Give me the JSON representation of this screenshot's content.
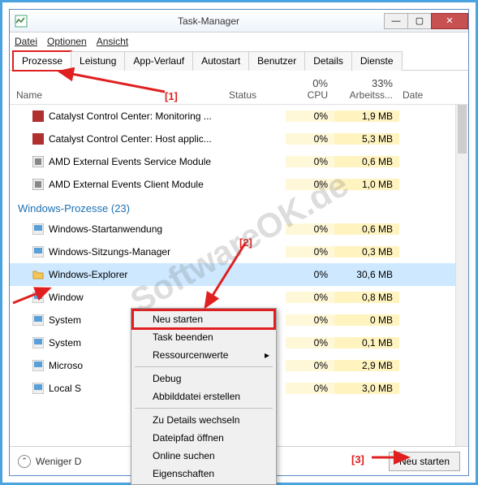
{
  "window": {
    "title": "Task-Manager",
    "btn_min": "—",
    "btn_max": "▢",
    "btn_close": "✕"
  },
  "menubar": {
    "file": "Datei",
    "options": "Optionen",
    "view": "Ansicht"
  },
  "tabs": {
    "items": [
      {
        "label": "Prozesse",
        "active": true
      },
      {
        "label": "Leistung"
      },
      {
        "label": "App-Verlauf"
      },
      {
        "label": "Autostart"
      },
      {
        "label": "Benutzer"
      },
      {
        "label": "Details"
      },
      {
        "label": "Dienste"
      }
    ]
  },
  "columns": {
    "name": "Name",
    "status": "Status",
    "cpu_pct": "0%",
    "cpu_label": "CPU",
    "mem_pct": "33%",
    "mem_label": "Arbeitss...",
    "date": "Date"
  },
  "processes": [
    {
      "name": "Catalyst Control Center: Monitoring ...",
      "cpu": "0%",
      "mem": "1,9 MB",
      "icon": "ccc"
    },
    {
      "name": "Catalyst Control Center: Host applic...",
      "cpu": "0%",
      "mem": "5,3 MB",
      "icon": "ccc"
    },
    {
      "name": "AMD External Events Service Module",
      "cpu": "0%",
      "mem": "0,6 MB",
      "icon": "amd"
    },
    {
      "name": "AMD External Events Client Module",
      "cpu": "0%",
      "mem": "1,0 MB",
      "icon": "amd"
    }
  ],
  "group": {
    "label": "Windows-Prozesse (23)"
  },
  "winprocs": [
    {
      "name": "Windows-Startanwendung",
      "cpu": "0%",
      "mem": "0,6 MB"
    },
    {
      "name": "Windows-Sitzungs-Manager",
      "cpu": "0%",
      "mem": "0,3 MB"
    },
    {
      "name": "Windows-Explorer",
      "cpu": "0%",
      "mem": "30,6 MB",
      "selected": true,
      "folder": true
    },
    {
      "name": "Window",
      "cpu": "0%",
      "mem": "0,8 MB"
    },
    {
      "name": "System",
      "cpu": "0%",
      "mem": "0 MB"
    },
    {
      "name": "System",
      "cpu": "0%",
      "mem": "0,1 MB"
    },
    {
      "name": "Microso",
      "cpu": "0%",
      "mem": "2,9 MB"
    },
    {
      "name": "Local S",
      "cpu": "0%",
      "mem": "3,0 MB"
    }
  ],
  "context_menu": {
    "items": [
      {
        "label": "Neu starten",
        "highlight": true
      },
      {
        "label": "Task beenden"
      },
      {
        "label": "Ressourcenwerte",
        "submenu": true
      },
      {
        "sep": true
      },
      {
        "label": "Debug"
      },
      {
        "label": "Abbilddatei erstellen"
      },
      {
        "sep": true
      },
      {
        "label": "Zu Details wechseln"
      },
      {
        "label": "Dateipfad öffnen"
      },
      {
        "label": "Online suchen"
      },
      {
        "label": "Eigenschaften"
      }
    ]
  },
  "footer": {
    "fewer": "Weniger D",
    "chevron": "⌃",
    "end_task": "Neu starten"
  },
  "annotations": {
    "a1": "[1]",
    "a2": "[2]",
    "a3": "[3]"
  },
  "watermark": "SoftwareOK.de"
}
